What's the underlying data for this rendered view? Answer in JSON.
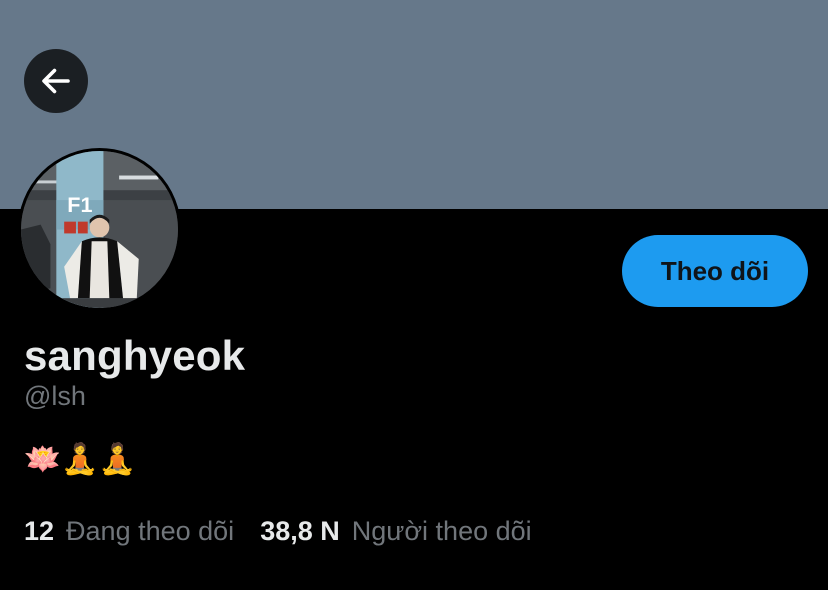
{
  "colors": {
    "banner": "#66788a",
    "background": "#000000",
    "accent": "#1d9bf0",
    "primary_text": "#e7e9ea",
    "secondary_text": "#71767b"
  },
  "header": {
    "back_icon": "arrow-left-icon"
  },
  "profile": {
    "avatar_icon": "avatar-photo",
    "follow_label": "Theo dõi",
    "display_name": "sanghyeok",
    "handle": "@lsh",
    "bio": "🪷🧘🧘"
  },
  "stats": {
    "following_count": "12",
    "following_label": "Đang theo dõi",
    "followers_count": "38,8 N",
    "followers_label": "Người theo dõi"
  }
}
